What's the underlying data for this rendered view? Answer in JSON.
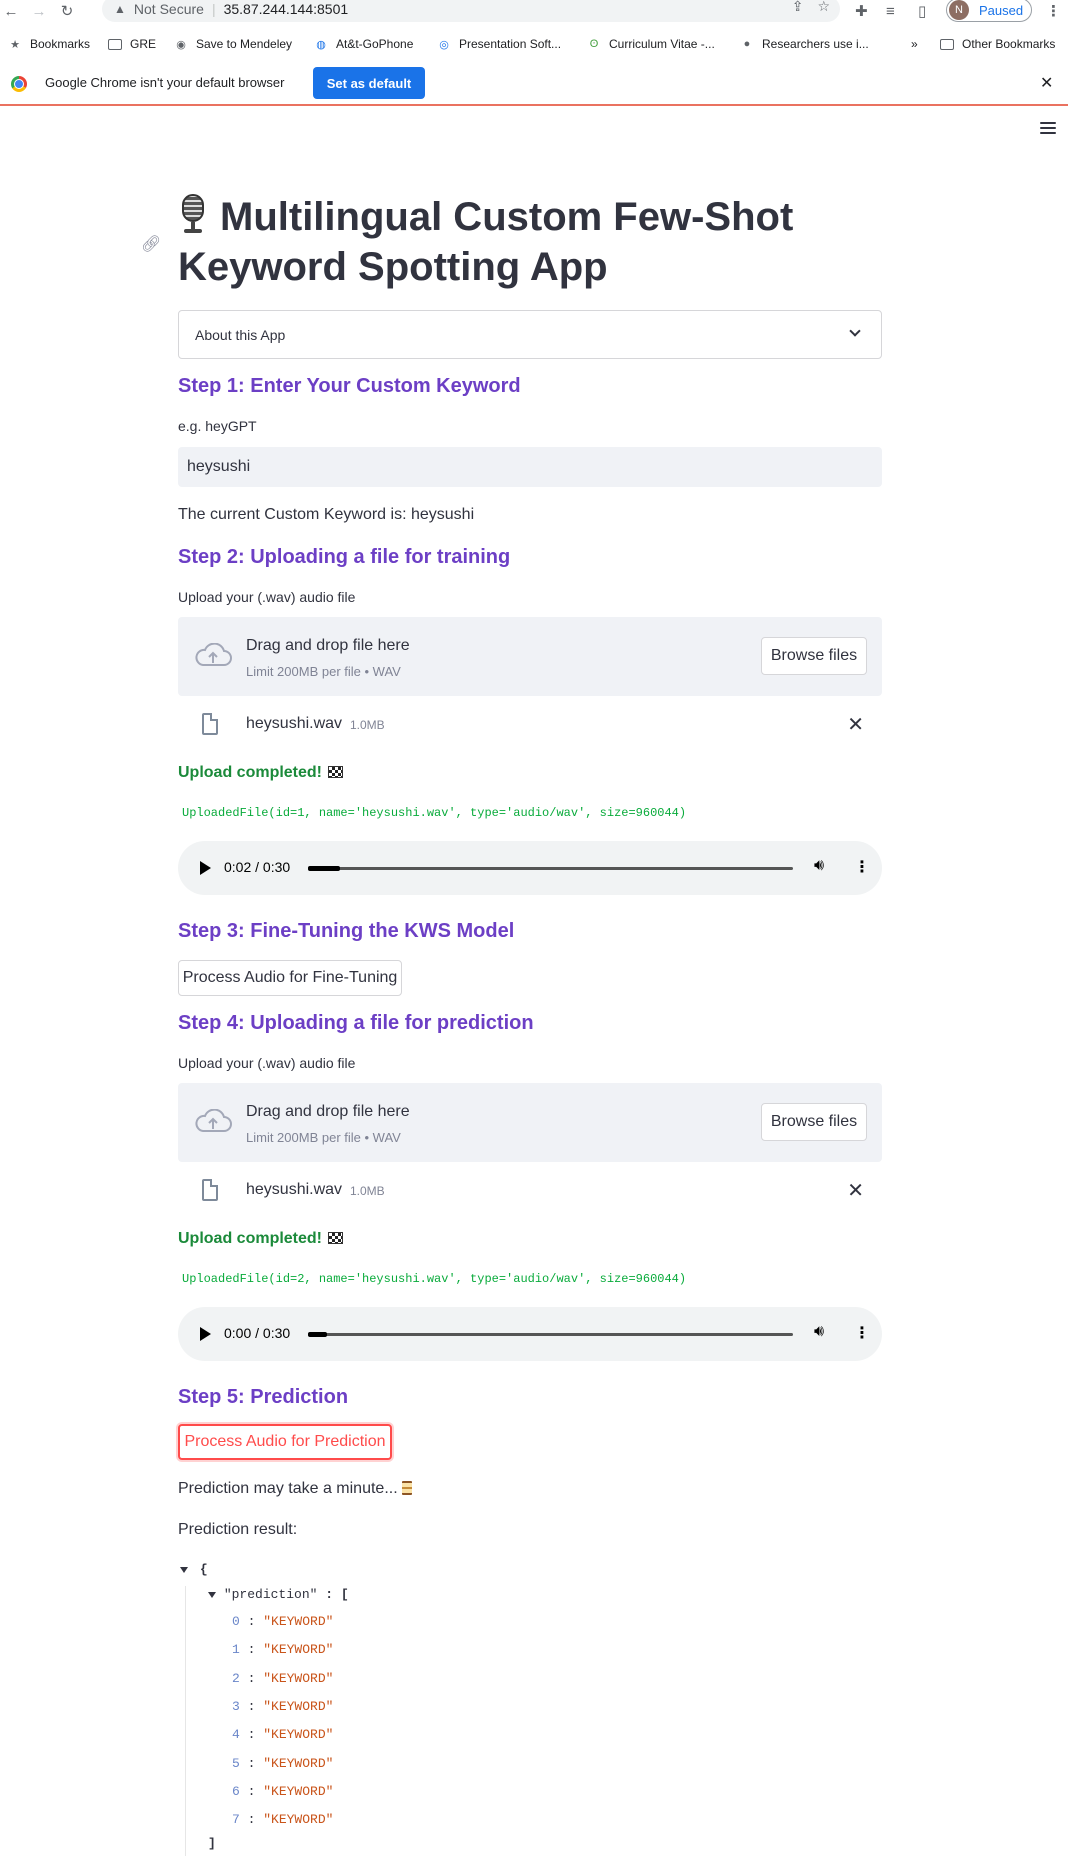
{
  "browser": {
    "security_label": "Not Secure",
    "url": "35.87.244.144:8501",
    "profile_initial": "N",
    "profile_status": "Paused",
    "bookmarks": [
      {
        "label": "Bookmarks",
        "icon": "star-icon"
      },
      {
        "label": "GRE",
        "icon": "folder-icon"
      },
      {
        "label": "Save to Mendeley",
        "icon": "mendeley-icon"
      },
      {
        "label": "At&t-GoPhone",
        "icon": "att-icon"
      },
      {
        "label": "Presentation Soft...",
        "icon": "globe-icon"
      },
      {
        "label": "Curriculum Vitae -...",
        "icon": "overleaf-icon"
      },
      {
        "label": "Researchers use i...",
        "icon": "site-icon"
      }
    ],
    "bookmarks_overflow": "»",
    "other_bookmarks": "Other Bookmarks",
    "infobar_text": "Google Chrome isn't your default browser",
    "set_default_label": "Set as default"
  },
  "app": {
    "title": "Multilingual Custom Few-Shot Keyword Spotting App",
    "about_label": "About this App",
    "step1": {
      "heading": "Step 1: Enter Your Custom Keyword",
      "input_label": "e.g. heyGPT",
      "input_value": "heysushi",
      "current_keyword_text": "The current Custom Keyword is: heysushi"
    },
    "step2": {
      "heading": "Step 2: Uploading a file for training",
      "uploader_label": "Upload your (.wav) audio file",
      "drop_main": "Drag and drop file here",
      "drop_sub": "Limit 200MB per file • WAV",
      "browse_label": "Browse files",
      "file_name": "heysushi.wav",
      "file_size": "1.0MB",
      "success_text": "Upload completed!",
      "uploaded_repr": "UploadedFile(id=1, name='heysushi.wav', type='audio/wav', size=960044)",
      "audio_time": "0:02 / 0:30",
      "audio_progress": 0.067
    },
    "step3": {
      "heading": "Step 3: Fine-Tuning the KWS Model",
      "button_label": "Process Audio for Fine-Tuning"
    },
    "step4": {
      "heading": "Step 4: Uploading a file for prediction",
      "uploader_label": "Upload your (.wav) audio file",
      "drop_main": "Drag and drop file here",
      "drop_sub": "Limit 200MB per file • WAV",
      "browse_label": "Browse files",
      "file_name": "heysushi.wav",
      "file_size": "1.0MB",
      "success_text": "Upload completed!",
      "uploaded_repr": "UploadedFile(id=2, name='heysushi.wav', type='audio/wav', size=960044)",
      "audio_time": "0:00 / 0:30",
      "audio_progress": 0.0
    },
    "step5": {
      "heading": "Step 5: Prediction",
      "button_label": "Process Audio for Prediction",
      "wait_text": "Prediction may take a minute...",
      "result_label": "Prediction result:",
      "json_open": "{",
      "json_key": "\"prediction\"",
      "json_array_open": ": [",
      "json_array_close": "]",
      "predictions": [
        "\"KEYWORD\"",
        "\"KEYWORD\"",
        "\"KEYWORD\"",
        "\"KEYWORD\"",
        "\"KEYWORD\"",
        "\"KEYWORD\"",
        "\"KEYWORD\"",
        "\"KEYWORD\""
      ]
    }
  },
  "colors": {
    "step_heading": "#6c3fc5",
    "success": "#1b8a3a",
    "primary_button": "#ff4b4b",
    "chrome_blue": "#1a73e8"
  }
}
